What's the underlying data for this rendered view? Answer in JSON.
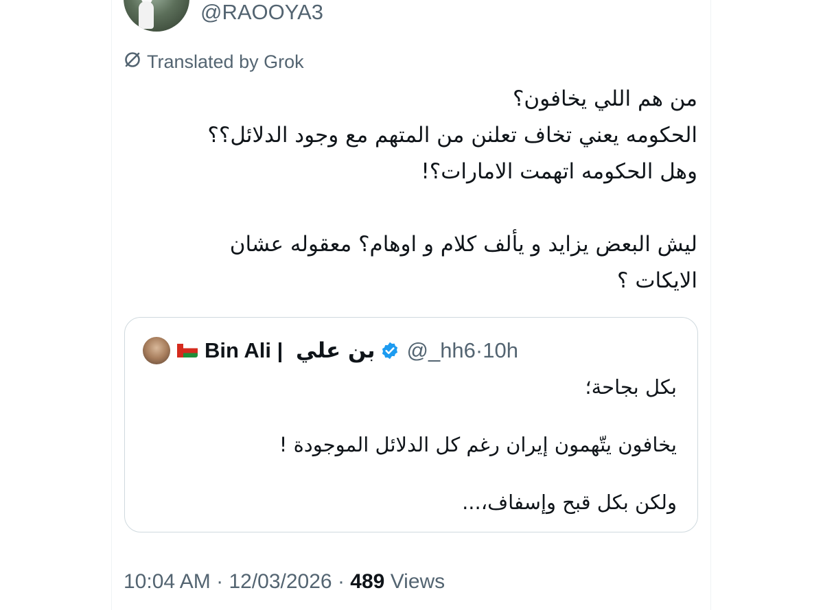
{
  "author": {
    "handle": "@RAOOYA3"
  },
  "translation": {
    "label": "Translated by Grok"
  },
  "tweet": {
    "lines": [
      "من هم اللي يخافون؟",
      "الحكومه يعني تخاف تعلنن من المتهم مع وجود الدلائل؟؟",
      "وهل الحكومه اتهمت الامارات؟!",
      "",
      "ليش البعض يزايد و يألف كلام و اوهام؟ معقوله عشان",
      "الايكات ؟"
    ]
  },
  "quote": {
    "name_en": "Bin Ali",
    "separator": "|",
    "name_ar": "بن علي",
    "handle": "@_hh6",
    "dot": "·",
    "time": "10h",
    "lines": [
      "بكل بجاحة؛",
      "",
      "يخافون يتّهمون إيران رغم كل الدلائل الموجودة !",
      "",
      "ولكن بكل قبح وإسفاف،..."
    ],
    "verified_color": "#1d9bf0"
  },
  "meta": {
    "time": "10:04 AM",
    "dot1": "·",
    "date": "12/03/2026",
    "dot2": "·",
    "views_count": "489",
    "views_label": "Views"
  },
  "colors": {
    "text": "#0f1419",
    "secondary": "#536471",
    "border": "#cfd9de"
  },
  "icons": {
    "translate": "grok-translate-icon",
    "verified": "verified-badge-icon",
    "flag": "oman-flag-icon"
  }
}
